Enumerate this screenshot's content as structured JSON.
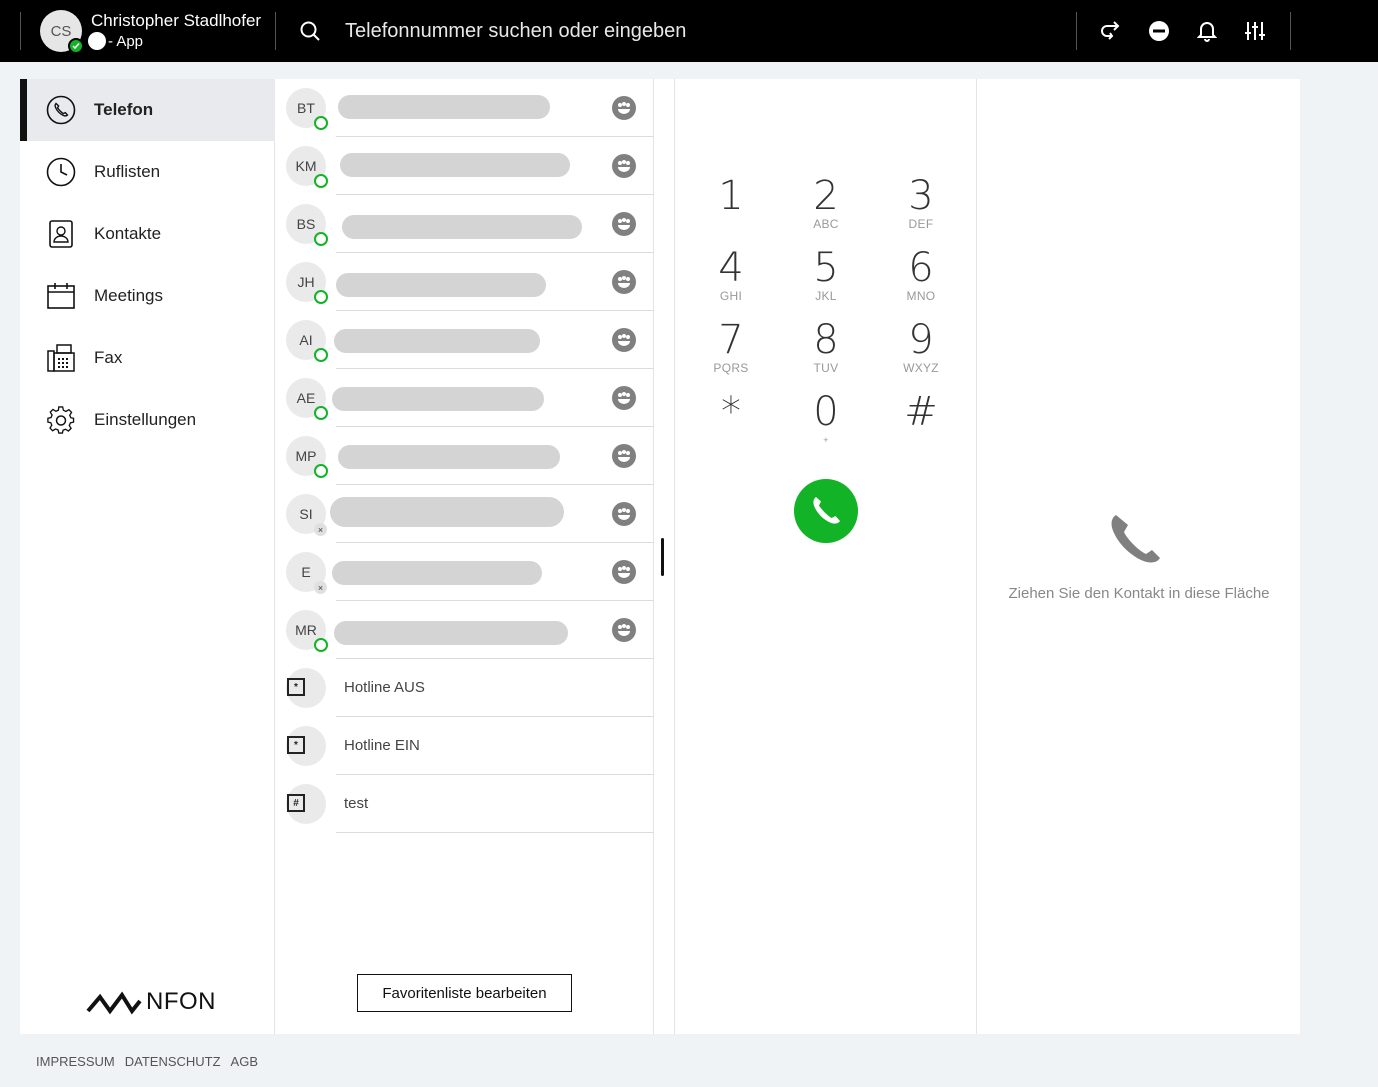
{
  "user": {
    "initials": "CS",
    "name": "Christopher Stadlhofer",
    "device": "- App"
  },
  "search": {
    "placeholder": "Telefonnummer suchen oder eingeben"
  },
  "toolbar": {
    "icons": [
      "call-forward-icon",
      "do-not-disturb-icon",
      "bell-icon",
      "settings-sliders-icon"
    ]
  },
  "colors": {
    "accent_green": "#12b326",
    "topbar": "#000000",
    "active_nav_bg": "#e8eaed"
  },
  "sidebar": {
    "items": [
      {
        "label": "Telefon",
        "icon": "phone-icon",
        "active": true
      },
      {
        "label": "Ruflisten",
        "icon": "clock-icon",
        "active": false
      },
      {
        "label": "Kontakte",
        "icon": "contact-card-icon",
        "active": false
      },
      {
        "label": "Meetings",
        "icon": "calendar-icon",
        "active": false
      },
      {
        "label": "Fax",
        "icon": "fax-icon",
        "active": false
      },
      {
        "label": "Einstellungen",
        "icon": "gear-icon",
        "active": false
      }
    ],
    "logo": "NFON"
  },
  "favorites": {
    "contacts": [
      {
        "initials": "BT",
        "status": "online"
      },
      {
        "initials": "KM",
        "status": "online"
      },
      {
        "initials": "BS",
        "status": "online"
      },
      {
        "initials": "JH",
        "status": "online"
      },
      {
        "initials": "AI",
        "status": "online"
      },
      {
        "initials": "AE",
        "status": "online"
      },
      {
        "initials": "MP",
        "status": "online"
      },
      {
        "initials": "SI",
        "status": "offline"
      },
      {
        "initials": "E",
        "status": "offline"
      },
      {
        "initials": "MR",
        "status": "online"
      }
    ],
    "functions": [
      {
        "symbol": "*",
        "label": "Hotline AUS"
      },
      {
        "symbol": "*",
        "label": "Hotline EIN"
      },
      {
        "symbol": "#",
        "label": "test"
      }
    ],
    "edit_button": "Favoritenliste bearbeiten"
  },
  "dialpad": {
    "keys": [
      {
        "digit": "1",
        "letters": ""
      },
      {
        "digit": "2",
        "letters": "ABC"
      },
      {
        "digit": "3",
        "letters": "DEF"
      },
      {
        "digit": "4",
        "letters": "GHI"
      },
      {
        "digit": "5",
        "letters": "JKL"
      },
      {
        "digit": "6",
        "letters": "MNO"
      },
      {
        "digit": "7",
        "letters": "PQRS"
      },
      {
        "digit": "8",
        "letters": "TUV"
      },
      {
        "digit": "9",
        "letters": "WXYZ"
      },
      {
        "digit": "*",
        "letters": ""
      },
      {
        "digit": "0",
        "letters": "+"
      },
      {
        "digit": "#",
        "letters": ""
      }
    ]
  },
  "dropzone": {
    "text": "Ziehen Sie den Kontakt in diese Fläche"
  },
  "footer": {
    "links": [
      "IMPRESSUM",
      "DATENSCHUTZ",
      "AGB"
    ]
  }
}
